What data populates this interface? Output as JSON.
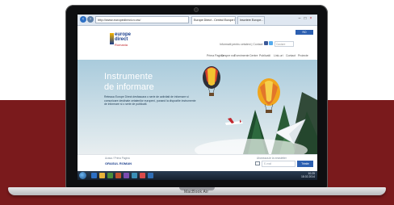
{
  "device": {
    "brand_label": "MacBook Air"
  },
  "browser": {
    "url": "http://www.europedirect-ro.eu/",
    "tabs": [
      {
        "label": "Europe Direct - Centrul Europe D...",
        "active": true
      },
      {
        "label": "Inscriere Europe...",
        "active": false
      }
    ],
    "nav": {
      "back_icon": "arrow-left-icon",
      "forward_icon": "arrow-right-icon"
    }
  },
  "site": {
    "logo": {
      "line1": "europe",
      "line2": "direct",
      "line3": "Romania"
    },
    "top_links": "Informatii pentru cetateni  |  Contact",
    "search_placeholder": "Cautare",
    "language": "RO",
    "menu": [
      "Prima Pagina",
      "Despre noi",
      "Evenimente",
      "Centre",
      "Publicatii",
      "Link-uri",
      "Contact",
      "Proiecte"
    ]
  },
  "hero": {
    "title_line1": "Instrumente",
    "title_line2": "de informare",
    "text": "Reteaua Europe Direct desfasoara o serie de activitati de informare si comunicare destinate cetatenilor europeni, punand la dispozitie instrumente de informare si o serie de publicatii."
  },
  "content": {
    "breadcrumb": "Acasa  /  Prima Pagina",
    "section_title": "ORASUL ROMAN",
    "newsletter_label": "Aboneaza-te la newsletter",
    "newsletter_placeholder": "E-mail",
    "newsletter_button": "Trimite"
  },
  "taskbar": {
    "time": "10:25",
    "date": "18.02.2014"
  },
  "colors": {
    "background_band": "#7a1a1c",
    "site_blue": "#1a3e8c",
    "accent_red": "#c1272d"
  }
}
